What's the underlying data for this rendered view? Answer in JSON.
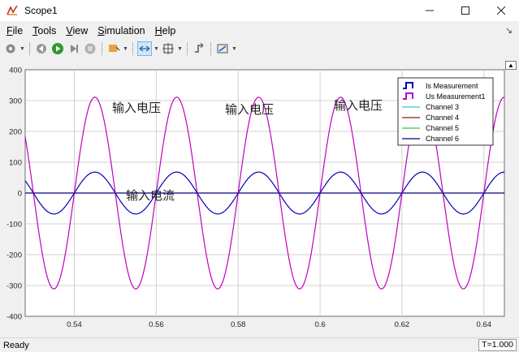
{
  "window": {
    "title": "Scope1"
  },
  "menu": [
    {
      "key": "F",
      "rest": "ile"
    },
    {
      "key": "T",
      "rest": "ools"
    },
    {
      "key": "V",
      "rest": "iew"
    },
    {
      "key": "S",
      "rest": "imulation"
    },
    {
      "key": "H",
      "rest": "elp"
    }
  ],
  "toolbar": {
    "icons": [
      "settings-icon",
      "step-back-icon",
      "run-icon",
      "step-forward-icon",
      "stop-icon",
      "highlight-icon",
      "zoom-icon",
      "autoscale-icon",
      "triggers-icon",
      "cursor-measurements-icon"
    ]
  },
  "status": {
    "text": "Ready",
    "time": "T=1.000"
  },
  "colors": {
    "is": "#0000b8",
    "us": "#c000c0",
    "ch3": "#33cccc",
    "ch4": "#8b1a1a",
    "ch5": "#33cc33",
    "ch6": "#000080"
  },
  "chart_data": {
    "type": "line",
    "title": "",
    "xlabel": "",
    "ylabel": "",
    "xlim": [
      0.528,
      0.645
    ],
    "ylim": [
      -400,
      400
    ],
    "xticks": [
      "0.54",
      "0.56",
      "0.58",
      "0.6",
      "0.62",
      "0.64"
    ],
    "yticks": [
      "400",
      "300",
      "200",
      "100",
      "0",
      "-100",
      "-200",
      "-300",
      "-400"
    ],
    "grid": true,
    "legend_position": "top-right",
    "series": [
      {
        "name": "Is Measurement",
        "kind": "sine",
        "amplitude": 68,
        "frequency_hz": 50,
        "phase_zero_at": 0.54,
        "color": "#0000b8"
      },
      {
        "name": "Us Measurement1",
        "kind": "sine",
        "amplitude": 311,
        "frequency_hz": 50,
        "phase_zero_at": 0.54,
        "color": "#c000c0"
      },
      {
        "name": "Channel 3",
        "kind": "none",
        "color": "#33cccc"
      },
      {
        "name": "Channel 4",
        "kind": "none",
        "color": "#8b1a1a"
      },
      {
        "name": "Channel 5",
        "kind": "none",
        "color": "#33cc33"
      },
      {
        "name": "Channel 6",
        "kind": "constant",
        "value": 0,
        "color": "#000080"
      }
    ],
    "annotations": [
      "输入电压",
      "输入电压",
      "输入电压",
      "输入电流"
    ]
  }
}
